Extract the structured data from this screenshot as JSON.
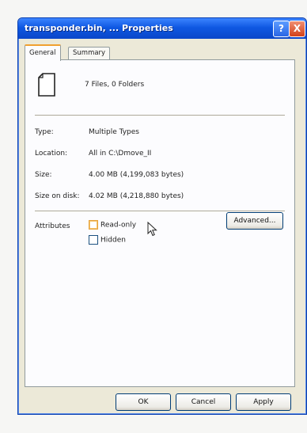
{
  "window": {
    "title": "transponder.bin, ... Properties",
    "help_label": "?",
    "close_label": "X"
  },
  "tabs": [
    {
      "label": "General",
      "selected": true
    },
    {
      "label": "Summary",
      "selected": false
    }
  ],
  "summary": {
    "file_count": "7 Files, 0 Folders",
    "icon": "document-icon"
  },
  "properties": {
    "type_label": "Type:",
    "type_value": "Multiple Types",
    "location_label": "Location:",
    "location_value": "All in C:\\Dmove_II",
    "size_label": "Size:",
    "size_value": "4.00 MB (4,199,083 bytes)",
    "size_on_disk_label": "Size on disk:",
    "size_on_disk_value": "4.02 MB (4,218,880 bytes)"
  },
  "attributes": {
    "label": "Attributes",
    "read_only_label": "Read-only",
    "read_only_checked": false,
    "hidden_label": "Hidden",
    "hidden_checked": false,
    "advanced_label": "Advanced..."
  },
  "footer": {
    "ok_label": "OK",
    "cancel_label": "Cancel",
    "apply_label": "Apply"
  }
}
